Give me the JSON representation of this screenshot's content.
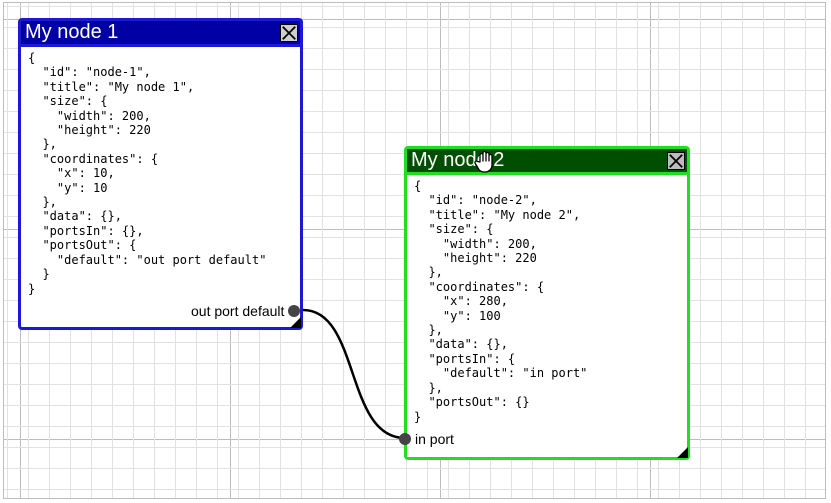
{
  "nodes": [
    {
      "title": "My node 1",
      "body": "{\n  \"id\": \"node-1\",\n  \"title\": \"My node 1\",\n  \"size\": {\n    \"width\": 200,\n    \"height\": 220\n  },\n  \"coordinates\": {\n    \"x\": 10,\n    \"y\": 10\n  },\n  \"data\": {},\n  \"portsIn\": {},\n  \"portsOut\": {\n    \"default\": \"out port default\"\n  }\n}",
      "port_label": "out port default",
      "border_color": "#1a1ad6",
      "header_color": "#0000a4"
    },
    {
      "title": "My node 2",
      "body": "{\n  \"id\": \"node-2\",\n  \"title\": \"My node 2\",\n  \"size\": {\n    \"width\": 200,\n    \"height\": 220\n  },\n  \"coordinates\": {\n    \"x\": 280,\n    \"y\": 100\n  },\n  \"data\": {},\n  \"portsIn\": {\n    \"default\": \"in port\"\n  },\n  \"portsOut\": {}\n}",
      "port_label": "in port",
      "border_color": "#22dd22",
      "header_color": "#004f00"
    }
  ],
  "icons": {
    "close": "close-icon",
    "cursor": "grab-hand-cursor-icon",
    "resize": "resize-handle-icon"
  }
}
